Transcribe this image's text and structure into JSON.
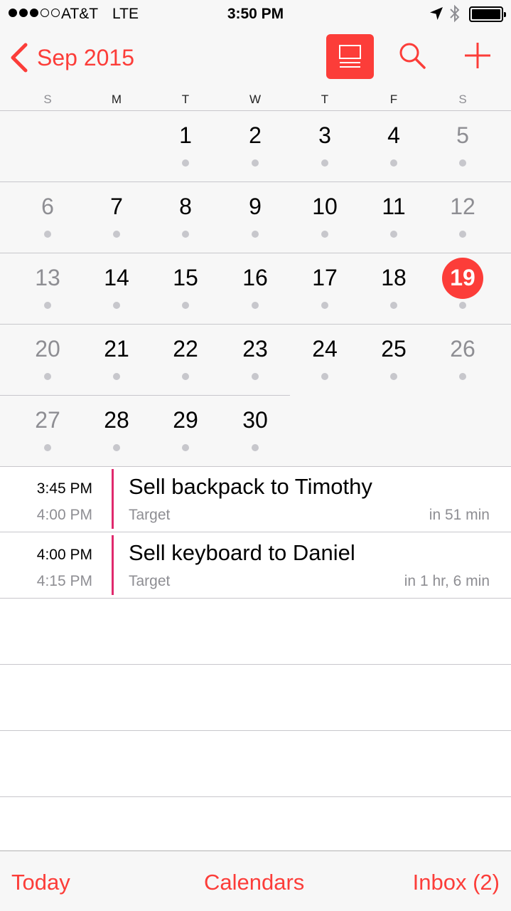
{
  "status_bar": {
    "carrier": "AT&T",
    "network": "LTE",
    "time": "3:50 PM",
    "signal_bars_filled": 3,
    "signal_bars_total": 5,
    "icons": [
      "location-arrow-icon",
      "bluetooth-icon",
      "battery-icon"
    ],
    "battery_level": 1.0
  },
  "nav": {
    "back_label": "Sep 2015",
    "icons": [
      "chevron-left-icon",
      "list-view-icon",
      "search-icon",
      "plus-icon"
    ]
  },
  "weekdays": [
    "S",
    "M",
    "T",
    "W",
    "T",
    "F",
    "S"
  ],
  "month": {
    "weeks": [
      [
        "",
        "",
        "1",
        "2",
        "3",
        "4",
        "5"
      ],
      [
        "6",
        "7",
        "8",
        "9",
        "10",
        "11",
        "12"
      ],
      [
        "13",
        "14",
        "15",
        "16",
        "17",
        "18",
        "19"
      ],
      [
        "20",
        "21",
        "22",
        "23",
        "24",
        "25",
        "26"
      ],
      [
        "27",
        "28",
        "29",
        "30",
        "",
        "",
        ""
      ]
    ],
    "selected_day": "19"
  },
  "events": [
    {
      "start": "3:45 PM",
      "end": "4:00 PM",
      "title": "Sell backpack to Timothy",
      "location": "Target",
      "until": "in 51 min"
    },
    {
      "start": "4:00 PM",
      "end": "4:15 PM",
      "title": "Sell keyboard to Daniel",
      "location": "Target",
      "until": "in 1 hr, 6 min"
    }
  ],
  "tab_bar": {
    "today": "Today",
    "calendars": "Calendars",
    "inbox": "Inbox (2)"
  },
  "colors": {
    "accent": "#fc3d39",
    "event_calendar": "#e0296d",
    "secondary_text": "#8e8e93",
    "background_gray": "#f7f7f7"
  }
}
